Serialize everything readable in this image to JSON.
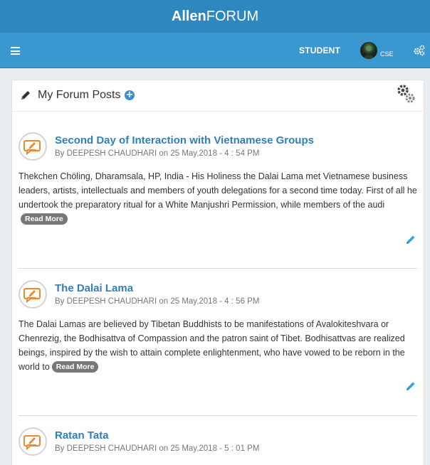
{
  "app": {
    "brand_bold": "Allen",
    "brand_regular": "FORUM"
  },
  "nav": {
    "role": "STUDENT",
    "dept": "CSE"
  },
  "card": {
    "title": "My Forum Posts"
  },
  "icons": {
    "menu": "hamburger-icon",
    "settings": "cogs-icon",
    "add": "plus-circle-icon",
    "edit": "pencil-icon",
    "post": "blog-chat-icon"
  },
  "colors": {
    "brand": "#2f87c0",
    "nav": "#3b97cf",
    "link": "#2f7fb8",
    "accent": "#f0882a"
  },
  "posts": [
    {
      "title": "Second Day of Interaction with Vietnamese Groups",
      "by": "By DEEPESH CHAUDHARI",
      "on": "on 25 May,2018 - 4 : 54 PM",
      "excerpt": "Thekchen Chöling, Dharamsala, HP, India - His Holiness the Dalai Lama met Vietnamese business leaders, artists, intellectuals and members of youth delegations for a second time today. First of all he undertook the preparatory ritual for a White Manjushri Permission, while members of the audi",
      "read_more": "Read More"
    },
    {
      "title": "The Dalai Lama",
      "by": "By DEEPESH CHAUDHARI",
      "on": "on 25 May,2018 - 4 : 56 PM",
      "excerpt": "The Dalai Lamas are believed by Tibetan Buddhists to be manifestations of Avalokiteshvara or Chenrezig, the Bodhisattva of Compassion and the patron saint of Tibet. Bodhisattvas are realized beings, inspired by the wish to attain complete enlightenment, who have vowed to be reborn in the world to",
      "read_more": "Read More"
    },
    {
      "title": "Ratan Tata",
      "by": "By DEEPESH CHAUDHARI",
      "on": "on 25 May,2018 - 5 : 01 PM"
    }
  ]
}
